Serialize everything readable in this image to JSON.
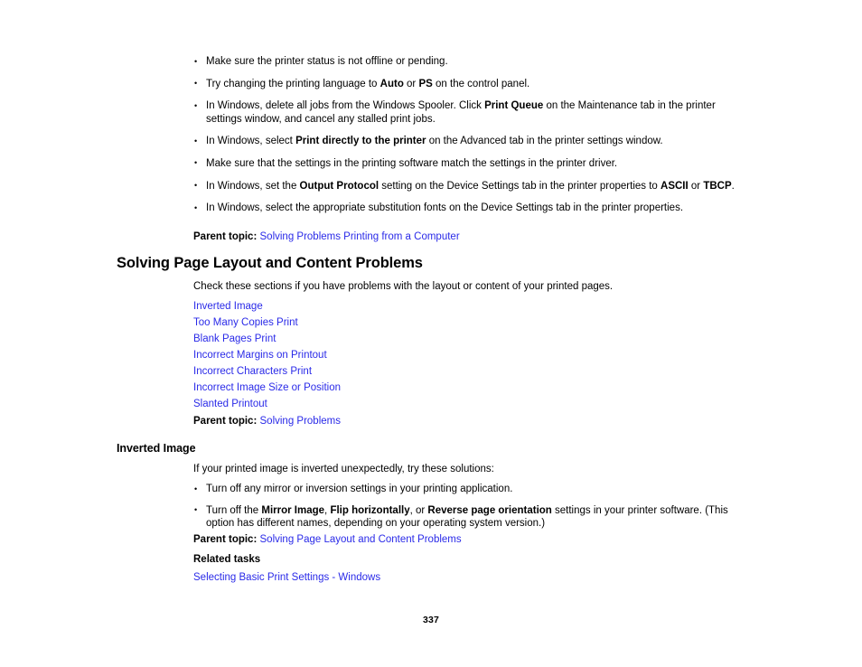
{
  "document": {
    "page_number": "337",
    "link_color": "#2a2ae8",
    "text_color": "#000000",
    "background_color": "#ffffff"
  },
  "top_bullets": [
    {
      "parts": [
        {
          "text": "Make sure the printer status is not offline or pending.",
          "bold": false
        }
      ]
    },
    {
      "parts": [
        {
          "text": "Try changing the printing language to ",
          "bold": false
        },
        {
          "text": "Auto",
          "bold": true
        },
        {
          "text": " or ",
          "bold": false
        },
        {
          "text": "PS",
          "bold": true
        },
        {
          "text": " on the control panel.",
          "bold": false
        }
      ]
    },
    {
      "parts": [
        {
          "text": "In Windows, delete all jobs from the Windows Spooler. Click ",
          "bold": false
        },
        {
          "text": "Print Queue",
          "bold": true
        },
        {
          "text": " on the Maintenance tab in the printer settings window, and cancel any stalled print jobs.",
          "bold": false
        }
      ]
    },
    {
      "parts": [
        {
          "text": "In Windows, select ",
          "bold": false
        },
        {
          "text": "Print directly to the printer",
          "bold": true
        },
        {
          "text": " on the Advanced tab in the printer settings window.",
          "bold": false
        }
      ]
    },
    {
      "parts": [
        {
          "text": "Make sure that the settings in the printing software match the settings in the printer driver.",
          "bold": false
        }
      ]
    },
    {
      "parts": [
        {
          "text": "In Windows, set the ",
          "bold": false
        },
        {
          "text": "Output Protocol",
          "bold": true
        },
        {
          "text": " setting on the Device Settings tab in the printer properties to ",
          "bold": false
        },
        {
          "text": "ASCII",
          "bold": true
        },
        {
          "text": " or ",
          "bold": false
        },
        {
          "text": "TBCP",
          "bold": true
        },
        {
          "text": ".",
          "bold": false
        }
      ]
    },
    {
      "parts": [
        {
          "text": "In Windows, select the appropriate substitution fonts on the Device Settings tab in the printer properties.",
          "bold": false
        }
      ]
    }
  ],
  "top_parent_topic": {
    "label": "Parent topic:",
    "link": "Solving Problems Printing from a Computer"
  },
  "section": {
    "title": "Solving Page Layout and Content Problems",
    "intro": "Check these sections if you have problems with the layout or content of your printed pages.",
    "links": [
      "Inverted Image",
      "Too Many Copies Print",
      "Blank Pages Print",
      "Incorrect Margins on Printout",
      "Incorrect Characters Print",
      "Incorrect Image Size or Position",
      "Slanted Printout"
    ],
    "parent_topic": {
      "label": "Parent topic:",
      "link": "Solving Problems"
    }
  },
  "subsection": {
    "title": "Inverted Image",
    "intro": "If your printed image is inverted unexpectedly, try these solutions:",
    "bullets": [
      {
        "parts": [
          {
            "text": "Turn off any mirror or inversion settings in your printing application.",
            "bold": false
          }
        ]
      },
      {
        "parts": [
          {
            "text": "Turn off the ",
            "bold": false
          },
          {
            "text": "Mirror Image",
            "bold": true
          },
          {
            "text": ", ",
            "bold": false
          },
          {
            "text": "Flip horizontally",
            "bold": true
          },
          {
            "text": ", or ",
            "bold": false
          },
          {
            "text": "Reverse page orientation",
            "bold": true
          },
          {
            "text": " settings in your printer software. (This option has different names, depending on your operating system version.)",
            "bold": false
          }
        ]
      }
    ],
    "parent_topic": {
      "label": "Parent topic:",
      "link": "Solving Page Layout and Content Problems"
    },
    "related_tasks": {
      "label": "Related tasks",
      "links": [
        "Selecting Basic Print Settings - Windows"
      ]
    }
  }
}
